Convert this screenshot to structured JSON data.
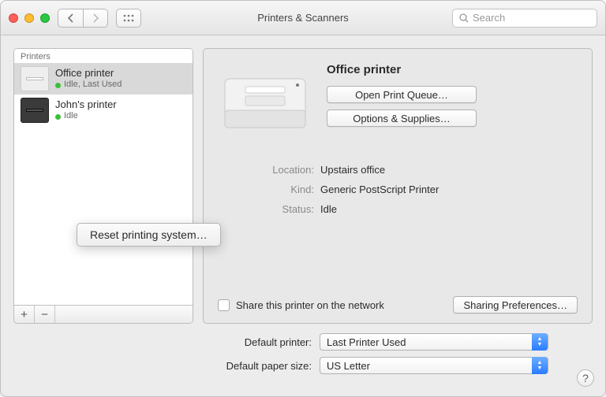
{
  "window_title": "Printers & Scanners",
  "search": {
    "placeholder": "Search"
  },
  "sidebar": {
    "header": "Printers",
    "items": [
      {
        "name": "Office printer",
        "status": "Idle, Last Used",
        "selected": true
      },
      {
        "name": "John's printer",
        "status": "Idle",
        "selected": false
      }
    ]
  },
  "context_menu": {
    "item": "Reset printing system…"
  },
  "detail": {
    "title": "Office printer",
    "open_queue_label": "Open Print Queue…",
    "options_supplies_label": "Options & Supplies…",
    "location_label": "Location:",
    "location_value": "Upstairs office",
    "kind_label": "Kind:",
    "kind_value": "Generic PostScript Printer",
    "status_label": "Status:",
    "status_value": "Idle",
    "share_label": "Share this printer on the network",
    "sharing_prefs_label": "Sharing Preferences…"
  },
  "settings": {
    "default_printer_label": "Default printer:",
    "default_printer_value": "Last Printer Used",
    "default_paper_label": "Default paper size:",
    "default_paper_value": "US Letter"
  },
  "help": "?"
}
